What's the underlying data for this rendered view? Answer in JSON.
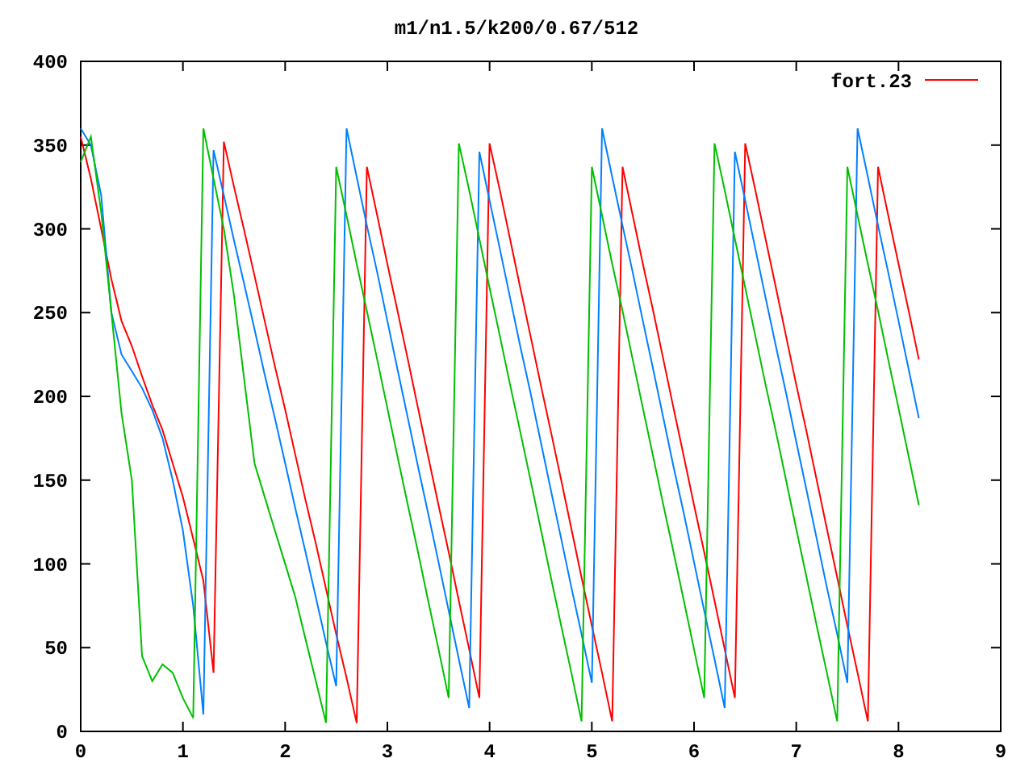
{
  "chart_data": {
    "type": "line",
    "title": "m1/n1.5/k200/0.67/512",
    "xlim": [
      0,
      9
    ],
    "ylim": [
      0,
      400
    ],
    "xticks": [
      0,
      1,
      2,
      3,
      4,
      5,
      6,
      7,
      8,
      9
    ],
    "yticks": [
      0,
      50,
      100,
      150,
      200,
      250,
      300,
      350,
      400
    ],
    "x": [
      0,
      0.1,
      0.2,
      0.3,
      0.4,
      0.5,
      0.6,
      0.7,
      0.8,
      0.9,
      1,
      1.1,
      1.2,
      1.3,
      1.4,
      1.5,
      1.6,
      1.7,
      1.8,
      1.9,
      2,
      2.1,
      2.2,
      2.3,
      2.4,
      2.5,
      2.6,
      2.7,
      2.8,
      2.9,
      3,
      3.1,
      3.2,
      3.3,
      3.4,
      3.5,
      3.6,
      3.7,
      3.8,
      3.9,
      4,
      4.1,
      4.2,
      4.3,
      4.4,
      4.5,
      4.6,
      4.7,
      4.8,
      4.9,
      5,
      5.1,
      5.2,
      5.3,
      5.4,
      5.5,
      5.6,
      5.7,
      5.8,
      5.9,
      6,
      6.1,
      6.2,
      6.3,
      6.4,
      6.5,
      6.6,
      6.7,
      6.8,
      6.9,
      7,
      7.1,
      7.2,
      7.3,
      7.4,
      7.5,
      7.6,
      7.7,
      7.8,
      7.9,
      8,
      8.1,
      8.2
    ],
    "series": [
      {
        "name": "fort.23",
        "color": "#ff0000",
        "values": [
          355,
          330,
          300,
          270,
          245,
          230,
          212,
          195,
          180,
          160,
          140,
          115,
          90,
          35,
          352,
          325,
          299,
          272,
          245,
          218,
          192,
          165,
          138,
          112,
          85,
          58,
          32,
          5,
          337,
          308,
          279,
          251,
          222,
          193,
          164,
          135,
          107,
          78,
          49,
          20,
          351,
          323,
          294,
          265,
          236,
          207,
          179,
          150,
          121,
          92,
          63,
          35,
          6,
          337,
          308,
          279,
          251,
          222,
          193,
          164,
          135,
          107,
          78,
          49,
          20,
          351,
          323,
          294,
          265,
          236,
          207,
          179,
          150,
          121,
          92,
          63,
          35,
          6,
          337,
          308,
          279,
          251,
          222
        ]
      },
      {
        "color": "#0080ff",
        "values": [
          360,
          350,
          320,
          250,
          225,
          215,
          205,
          192,
          175,
          150,
          120,
          75,
          10,
          347,
          320,
          293,
          267,
          240,
          213,
          187,
          160,
          133,
          107,
          80,
          53,
          27,
          360,
          331,
          302,
          274,
          245,
          216,
          187,
          158,
          130,
          101,
          72,
          43,
          14,
          346,
          317,
          288,
          259,
          230,
          202,
          173,
          144,
          115,
          86,
          58,
          29,
          360,
          331,
          302,
          274,
          245,
          216,
          187,
          158,
          130,
          101,
          72,
          43,
          14,
          346,
          317,
          288,
          259,
          230,
          202,
          173,
          144,
          115,
          86,
          58,
          29,
          360,
          331,
          302,
          274,
          245,
          216,
          187
        ]
      },
      {
        "color": "#00c000",
        "values": [
          340,
          355,
          310,
          250,
          190,
          150,
          45,
          30,
          40,
          35,
          20,
          8,
          360,
          330,
          300,
          260,
          210,
          160,
          140,
          120,
          100,
          80,
          55,
          30,
          5,
          337,
          308,
          279,
          251,
          222,
          193,
          164,
          135,
          107,
          78,
          49,
          20,
          351,
          323,
          294,
          265,
          236,
          207,
          179,
          150,
          121,
          92,
          63,
          35,
          6,
          337,
          308,
          279,
          251,
          222,
          193,
          164,
          135,
          107,
          78,
          49,
          20,
          351,
          323,
          294,
          265,
          236,
          207,
          179,
          150,
          121,
          92,
          63,
          35,
          6,
          337,
          308,
          279,
          251,
          222,
          193,
          164,
          135
        ]
      }
    ]
  }
}
